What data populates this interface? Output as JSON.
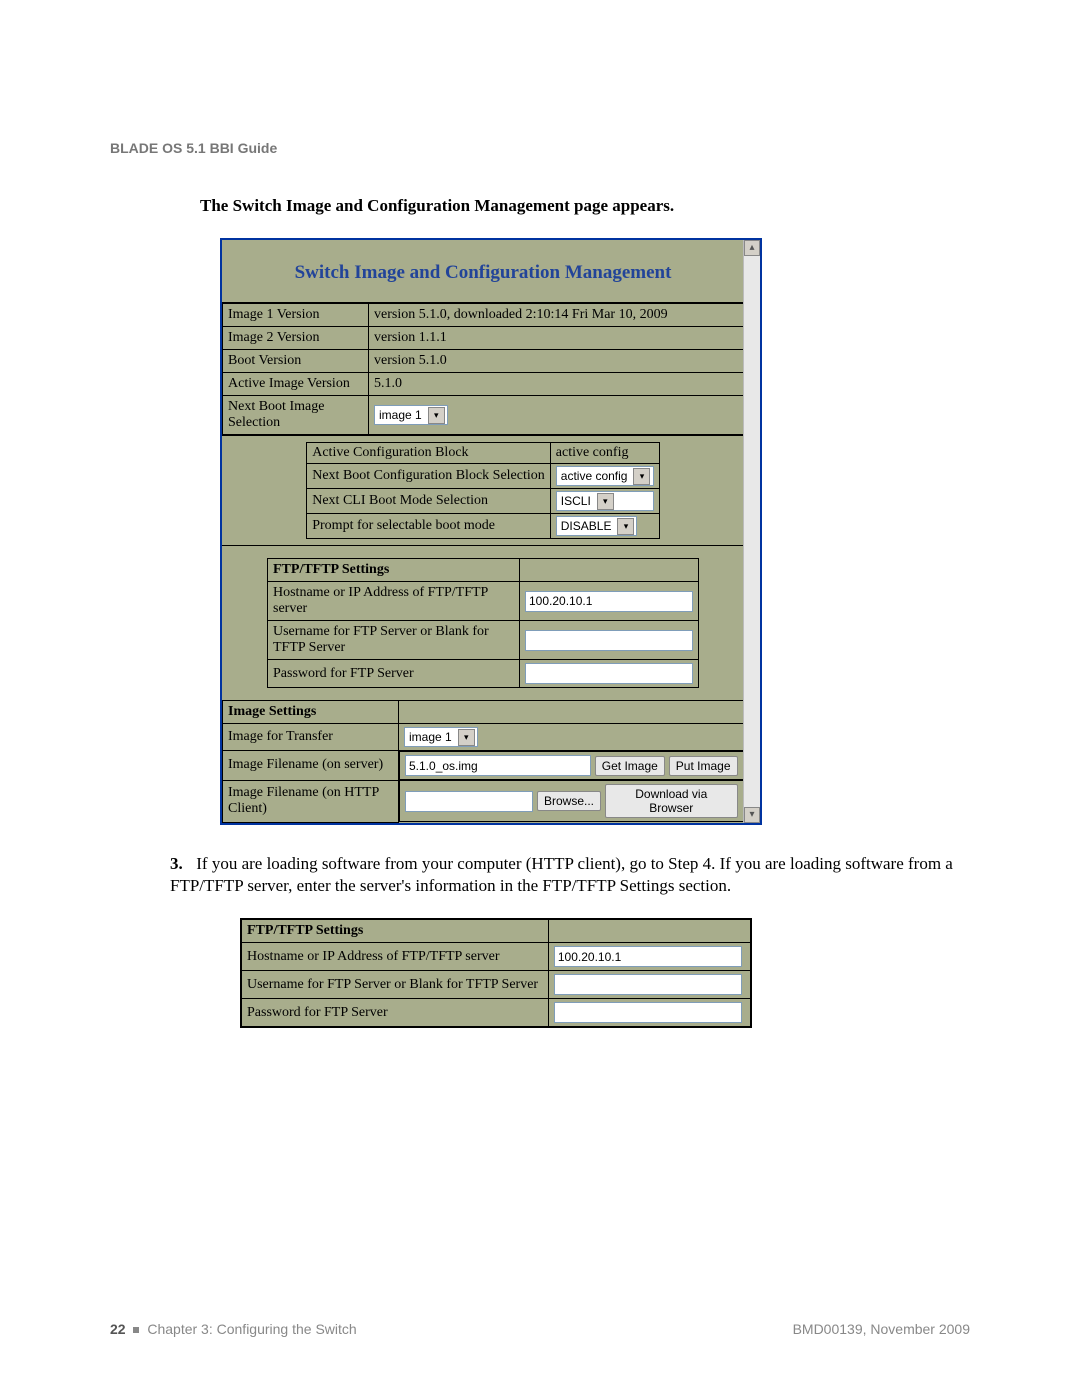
{
  "doc": {
    "header": "BLADE OS 5.1 BBI Guide",
    "intro": "The Switch Image and Configuration Management page appears.",
    "page_num": "22",
    "chapter": "Chapter 3: Configuring the Switch",
    "docref": "BMD00139, November 2009"
  },
  "panel": {
    "title": "Switch Image and Configuration Management",
    "rows": {
      "img1": {
        "label": "Image 1 Version",
        "value": "version 5.1.0, downloaded 2:10:14 Fri Mar 10, 2009"
      },
      "img2": {
        "label": "Image 2 Version",
        "value": "version 1.1.1"
      },
      "boot": {
        "label": "Boot Version",
        "value": "version 5.1.0"
      },
      "active": {
        "label": "Active Image Version",
        "value": "5.1.0"
      },
      "nextboot": {
        "label": "Next Boot Image Selection",
        "value": "image 1"
      }
    },
    "cfg_block": {
      "active": {
        "label": "Active Configuration Block",
        "value": "active config"
      },
      "nextcfg": {
        "label": "Next Boot Configuration Block Selection",
        "value": "active config"
      },
      "cli": {
        "label": "Next CLI Boot Mode Selection",
        "value": "ISCLI"
      },
      "prompt": {
        "label": "Prompt for selectable boot mode",
        "value": "DISABLE"
      }
    },
    "ftp": {
      "header": "FTP/TFTP Settings",
      "host": {
        "label": "Hostname or IP Address of FTP/TFTP server",
        "value": "100.20.10.1"
      },
      "user": {
        "label": "Username for FTP Server or Blank for TFTP Server",
        "value": ""
      },
      "pass": {
        "label": "Password for FTP Server",
        "value": ""
      }
    },
    "imgset": {
      "header": "Image Settings",
      "transfer": {
        "label": "Image for Transfer",
        "value": "image 1"
      },
      "fname": {
        "label": "Image Filename (on server)",
        "value": "5.1.0_os.img",
        "get": "Get Image",
        "put": "Put Image"
      },
      "http": {
        "label": "Image Filename (on HTTP Client)",
        "browse": "Browse...",
        "download": "Download via Browser"
      }
    },
    "scrollbar": {
      "up": "▴",
      "down": "▾"
    }
  },
  "step": {
    "num": "3.",
    "text": "If you are loading software from your computer (HTTP client), go to Step 4. If you are loading software from a FTP/TFTP server, enter the server's information in the FTP/TFTP Settings section."
  },
  "panel2": {
    "ftp": {
      "header": "FTP/TFTP Settings",
      "host": {
        "label": "Hostname or IP Address of FTP/TFTP server",
        "value": "100.20.10.1"
      },
      "user": {
        "label": "Username for FTP Server or Blank for TFTP Server",
        "value": ""
      },
      "pass": {
        "label": "Password for FTP Server",
        "value": ""
      }
    }
  }
}
